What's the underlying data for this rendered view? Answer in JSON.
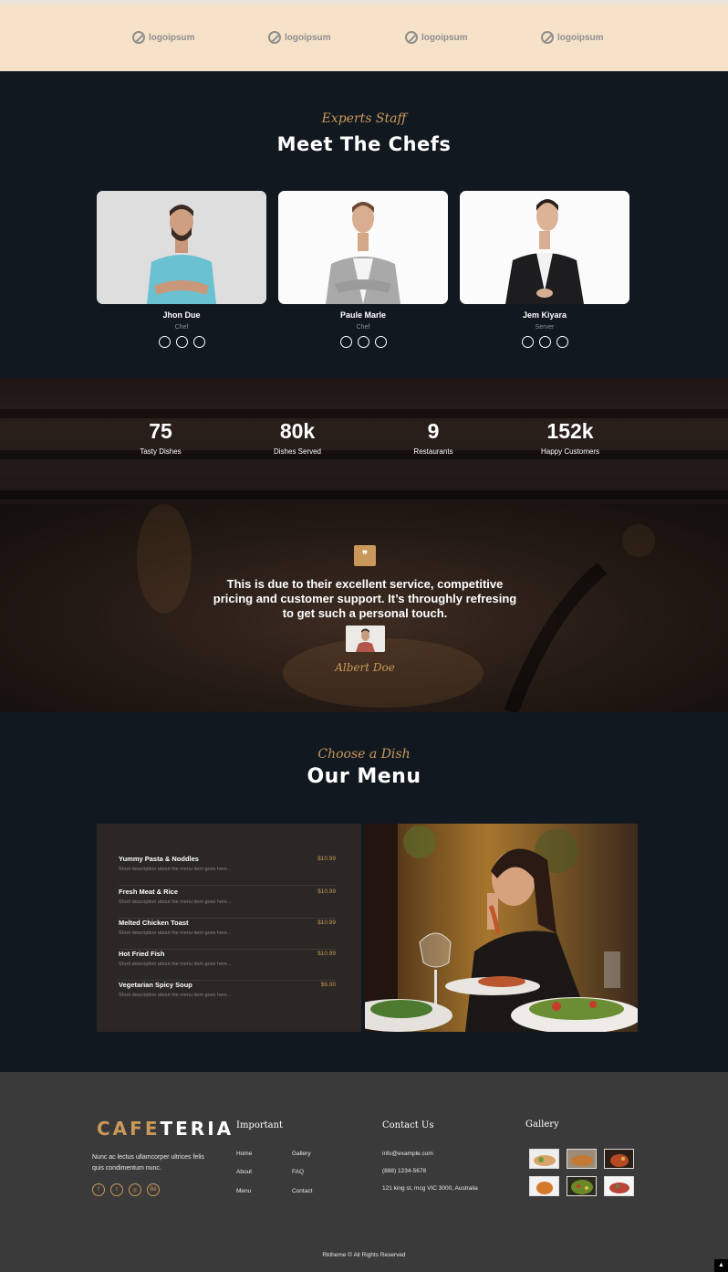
{
  "logos": [
    "logoipsum",
    "logoipsum",
    "logoipsum",
    "logoipsum"
  ],
  "chefs_section": {
    "script_title": "Experts Staff",
    "title": "Meet The Chefs",
    "chefs": [
      {
        "name": "Jhon Due",
        "role": "Chef"
      },
      {
        "name": "Paule Marle",
        "role": "Chef"
      },
      {
        "name": "Jem Kiyara",
        "role": "Server"
      }
    ]
  },
  "stats": [
    {
      "value": "75",
      "label": "Tasty Dishes"
    },
    {
      "value": "80k",
      "label": "Dishes Served"
    },
    {
      "value": "9",
      "label": "Restaurants"
    },
    {
      "value": "152k",
      "label": "Happy Customers"
    }
  ],
  "testimonial": {
    "quote_icon": "❞",
    "text": "This is due to their excellent service, competitive pricing and customer support. It’s throughly refresing to get such a personal touch.",
    "author": "Albert Doe"
  },
  "menu": {
    "script_title": "Choose a Dish",
    "title": "Our Menu",
    "items": [
      {
        "name": "Yummy Pasta & Noddles",
        "price": "$10.99",
        "desc": "Short description about the menu item goes here..."
      },
      {
        "name": "Fresh Meat & Rice",
        "price": "$10.99",
        "desc": "Short description about the menu item goes here..."
      },
      {
        "name": "Melted Chicken Toast",
        "price": "$10.99",
        "desc": "Short description about the menu item goes here..."
      },
      {
        "name": "Hot Fried Fish",
        "price": "$10.99",
        "desc": "Short description about the menu item goes here..."
      },
      {
        "name": "Vegetarian Spicy Soup",
        "price": "$6.00",
        "desc": "Short description about the menu item goes here..."
      }
    ]
  },
  "footer": {
    "brand_part1": "CAFE",
    "brand_part2": "TERIA",
    "description": "Nunc ac lectus ullamcorper ultrices felis quis condimentum nunc.",
    "social": [
      "f",
      "t",
      "◎",
      "Bē"
    ],
    "important_heading": "Important",
    "important_links": [
      "Home",
      "Gallery",
      "About",
      "FAQ",
      "Menu",
      "Contact"
    ],
    "contact_heading": "Contact Us",
    "contact": [
      "info@example.com",
      "(888) 1234-5678",
      "121 king st, mcg VIC 3000, Australia"
    ],
    "gallery_heading": "Gallery",
    "copyright": "Rktheme © All Rights Reserved",
    "to_top": "▲"
  },
  "colors": {
    "accent": "#c9995b",
    "dark": "#121820",
    "footer": "#3a3a3a",
    "cream": "#f6e2c9"
  }
}
